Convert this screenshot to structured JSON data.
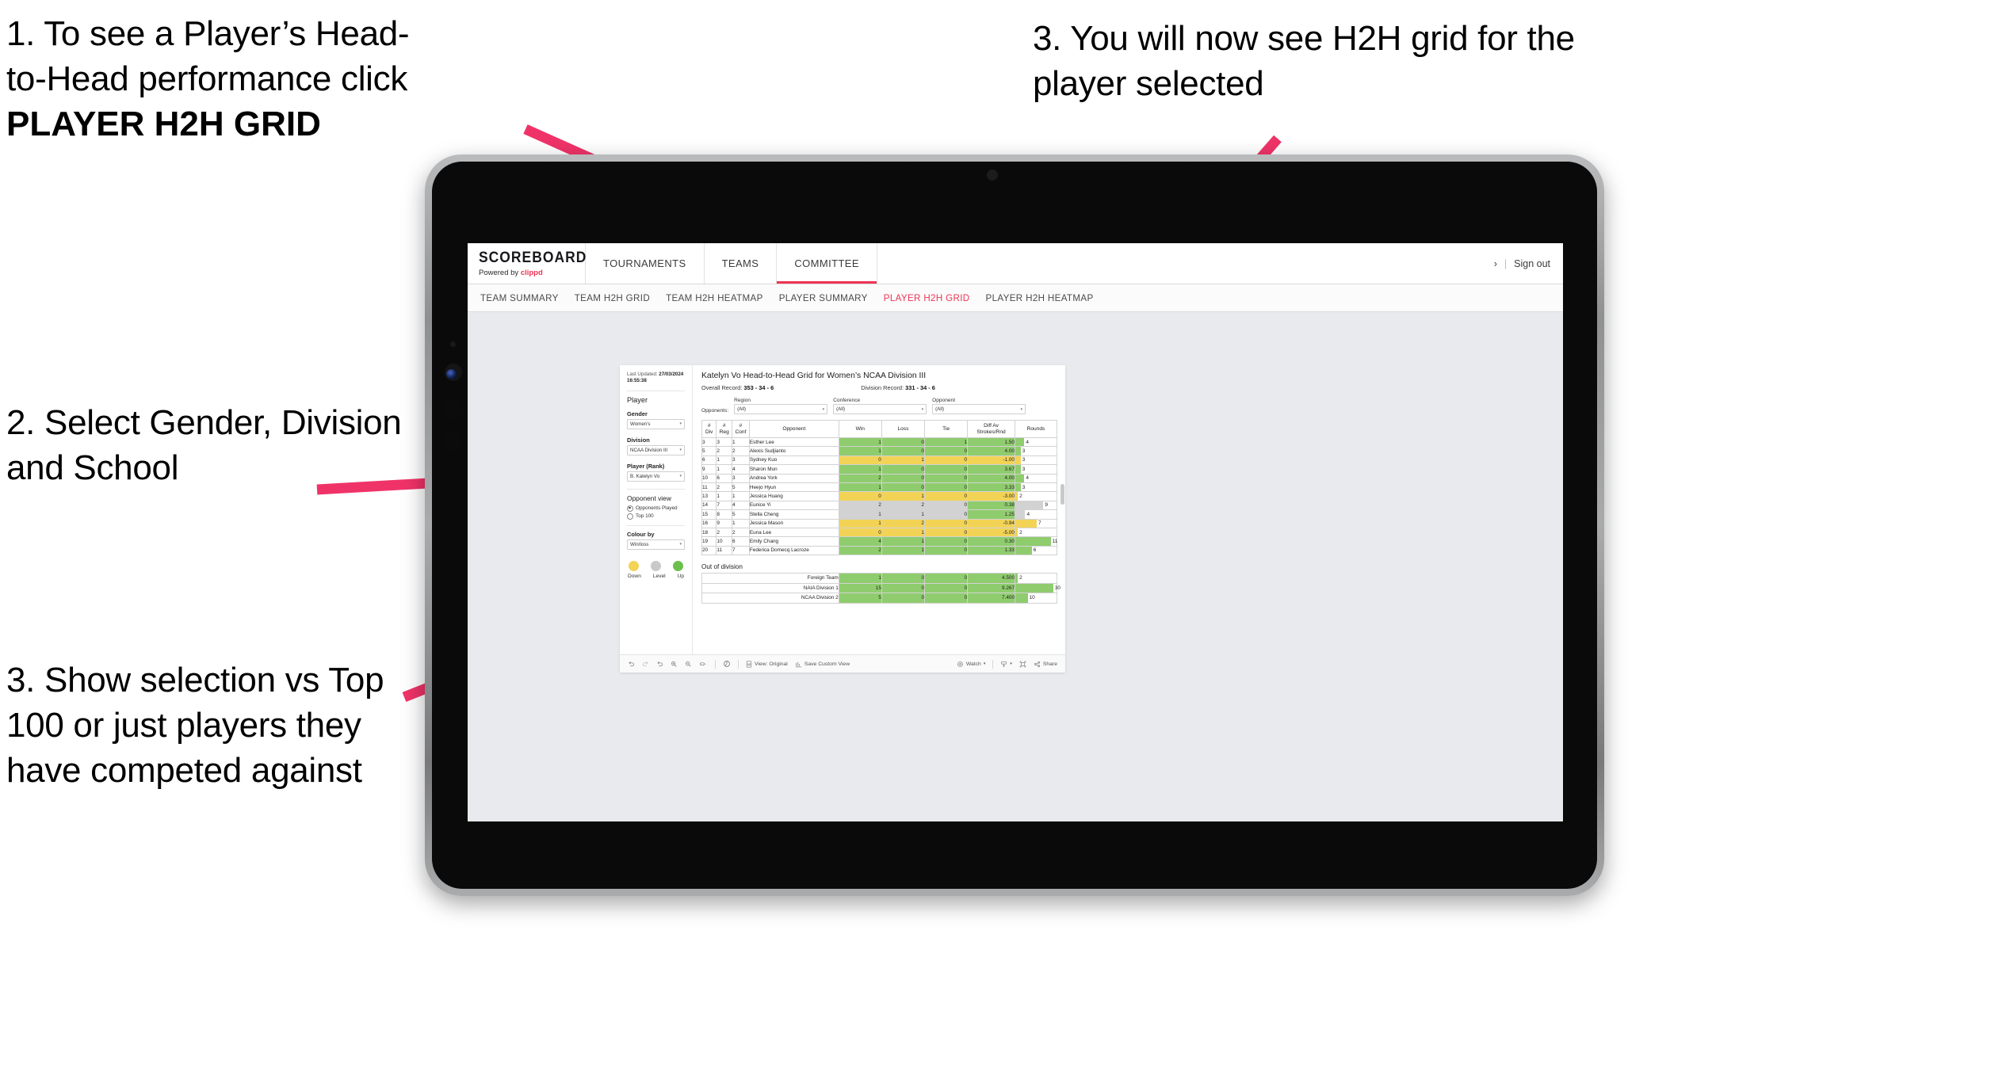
{
  "annotations": {
    "step1_line1": "1. To see a Player’s Head-",
    "step1_line2": "to-Head performance click",
    "step1_bold": "PLAYER H2H GRID",
    "step2": "2. Select Gender, Division and School",
    "step3_left": "3. Show selection vs Top 100 or just players they have competed against",
    "step3_right": "3. You will now see H2H grid for the player selected",
    "arrow_color": "#ef3368"
  },
  "app": {
    "brand": {
      "name": "SCOREBOARD",
      "powered_prefix": "Powered by ",
      "powered_brand": "clippd"
    },
    "main_nav": [
      {
        "label": "TOURNAMENTS",
        "active": false
      },
      {
        "label": "TEAMS",
        "active": false
      },
      {
        "label": "COMMITTEE",
        "active": true
      }
    ],
    "account": {
      "chevron": "›",
      "separator": "|",
      "sign_out": "Sign out"
    },
    "sub_nav": [
      {
        "label": "TEAM SUMMARY",
        "active": false
      },
      {
        "label": "TEAM H2H GRID",
        "active": false
      },
      {
        "label": "TEAM H2H HEATMAP",
        "active": false
      },
      {
        "label": "PLAYER SUMMARY",
        "active": false
      },
      {
        "label": "PLAYER H2H GRID",
        "active": true
      },
      {
        "label": "PLAYER H2H HEATMAP",
        "active": false
      }
    ]
  },
  "viz": {
    "sidebar": {
      "last_updated_label": "Last Updated:",
      "last_updated_date": "27/03/2024",
      "last_updated_time": "16:55:38",
      "section_player": "Player",
      "fields": [
        {
          "label": "Gender",
          "value": "Women's"
        },
        {
          "label": "Division",
          "value": "NCAA Division III"
        },
        {
          "label": "Player (Rank)",
          "value": "B. Katelyn Vo"
        }
      ],
      "opponent_view": {
        "title": "Opponent view",
        "options": [
          {
            "label": "Opponents Played",
            "selected": true
          },
          {
            "label": "Top 100",
            "selected": false
          }
        ]
      },
      "colour_by": {
        "label": "Colour by",
        "value": "Win/loss"
      },
      "legend": [
        {
          "label": "Down",
          "color": "#f2d356"
        },
        {
          "label": "Level",
          "color": "#c9c9c9"
        },
        {
          "label": "Up",
          "color": "#6cbf4b"
        }
      ]
    },
    "title": "Katelyn Vo Head-to-Head Grid for Women’s NCAA Division III",
    "overall_record_label": "Overall Record:",
    "overall_record_value": "353 - 34 - 6",
    "division_record_label": "Division Record:",
    "division_record_value": "331 - 34 - 6",
    "opponents_label": "Opponents:",
    "filters": [
      {
        "label": "Region",
        "value": "(All)"
      },
      {
        "label": "Conference",
        "value": "(All)"
      },
      {
        "label": "Opponent",
        "value": "(All)"
      }
    ],
    "out_of_division_title": "Out of division"
  },
  "toolbar": {
    "view_original": "View: Original",
    "save_custom_view": "Save Custom View",
    "watch": "Watch",
    "share": "Share"
  },
  "chart_data": {
    "type": "table",
    "title": "Katelyn Vo Head-to-Head Grid for Women’s NCAA Division III",
    "columns": [
      "# Div",
      "# Reg",
      "# Conf",
      "Opponent",
      "Win",
      "Loss",
      "Tie",
      "Diff Av Strokes/Rnd",
      "Rounds"
    ],
    "column_headers_split": [
      {
        "l1": "#",
        "l2": "Div"
      },
      {
        "l1": "#",
        "l2": "Reg"
      },
      {
        "l1": "#",
        "l2": "Conf"
      },
      {
        "l1": "Opponent",
        "l2": ""
      },
      {
        "l1": "Win",
        "l2": ""
      },
      {
        "l1": "Loss",
        "l2": ""
      },
      {
        "l1": "Tie",
        "l2": ""
      },
      {
        "l1": "Diff Av",
        "l2": "Strokes/Rnd"
      },
      {
        "l1": "Rounds",
        "l2": ""
      }
    ],
    "rows": [
      {
        "div": "3",
        "reg": "3",
        "conf": "1",
        "opponent": "Esther Lee",
        "win": "1",
        "loss": "0",
        "tie": "1",
        "diff": "1.50",
        "rounds": "4",
        "rounds_pct": 22,
        "state": "up"
      },
      {
        "div": "5",
        "reg": "2",
        "conf": "2",
        "opponent": "Alexis Sudjianto",
        "win": "1",
        "loss": "0",
        "tie": "0",
        "diff": "4.00",
        "rounds": "3",
        "rounds_pct": 13,
        "state": "up"
      },
      {
        "div": "6",
        "reg": "1",
        "conf": "3",
        "opponent": "Sydney Kuo",
        "win": "0",
        "loss": "1",
        "tie": "0",
        "diff": "-1.00",
        "rounds": "3",
        "rounds_pct": 13,
        "state": "down"
      },
      {
        "div": "9",
        "reg": "1",
        "conf": "4",
        "opponent": "Sharon Mun",
        "win": "1",
        "loss": "0",
        "tie": "0",
        "diff": "3.67",
        "rounds": "3",
        "rounds_pct": 13,
        "state": "up"
      },
      {
        "div": "10",
        "reg": "6",
        "conf": "3",
        "opponent": "Andrea York",
        "win": "2",
        "loss": "0",
        "tie": "0",
        "diff": "4.00",
        "rounds": "4",
        "rounds_pct": 22,
        "state": "up"
      },
      {
        "div": "11",
        "reg": "2",
        "conf": "5",
        "opponent": "Heejo Hyun",
        "win": "1",
        "loss": "0",
        "tie": "0",
        "diff": "3.33",
        "rounds": "3",
        "rounds_pct": 13,
        "state": "up"
      },
      {
        "div": "13",
        "reg": "1",
        "conf": "1",
        "opponent": "Jessica Huang",
        "win": "0",
        "loss": "1",
        "tie": "0",
        "diff": "-3.00",
        "rounds": "2",
        "rounds_pct": 6,
        "state": "down"
      },
      {
        "div": "14",
        "reg": "7",
        "conf": "4",
        "opponent": "Eunice Yi",
        "win": "2",
        "loss": "2",
        "tie": "0",
        "diff": "0.38",
        "rounds": "9",
        "rounds_pct": 68,
        "state": "level",
        "diff_state": "up"
      },
      {
        "div": "15",
        "reg": "8",
        "conf": "5",
        "opponent": "Stella Cheng",
        "win": "1",
        "loss": "1",
        "tie": "0",
        "diff": "1.25",
        "rounds": "4",
        "rounds_pct": 24,
        "state": "level",
        "diff_state": "up"
      },
      {
        "div": "16",
        "reg": "9",
        "conf": "1",
        "opponent": "Jessica Mason",
        "win": "1",
        "loss": "2",
        "tie": "0",
        "diff": "-0.94",
        "rounds": "7",
        "rounds_pct": 52,
        "state": "down"
      },
      {
        "div": "18",
        "reg": "2",
        "conf": "2",
        "opponent": "Euna Lee",
        "win": "0",
        "loss": "1",
        "tie": "0",
        "diff": "-5.00",
        "rounds": "2",
        "rounds_pct": 6,
        "state": "down"
      },
      {
        "div": "19",
        "reg": "10",
        "conf": "6",
        "opponent": "Emily Chang",
        "win": "4",
        "loss": "1",
        "tie": "0",
        "diff": "0.30",
        "rounds": "11",
        "rounds_pct": 86,
        "state": "up"
      },
      {
        "div": "20",
        "reg": "11",
        "conf": "7",
        "opponent": "Federica Domecq Lacroze",
        "win": "2",
        "loss": "1",
        "tie": "0",
        "diff": "1.33",
        "rounds": "6",
        "rounds_pct": 40,
        "state": "up"
      }
    ],
    "out_of_division_rows": [
      {
        "name": "Foreign Team",
        "win": "1",
        "loss": "0",
        "tie": "0",
        "diff": "4.500",
        "rounds": "2",
        "rounds_pct": 6,
        "state": "up"
      },
      {
        "name": "NAIA Division 1",
        "win": "15",
        "loss": "0",
        "tie": "0",
        "diff": "9.267",
        "rounds": "30",
        "rounds_pct": 92,
        "state": "up"
      },
      {
        "name": "NCAA Division 2",
        "win": "5",
        "loss": "0",
        "tie": "0",
        "diff": "7.400",
        "rounds": "10",
        "rounds_pct": 30,
        "state": "up"
      }
    ]
  }
}
